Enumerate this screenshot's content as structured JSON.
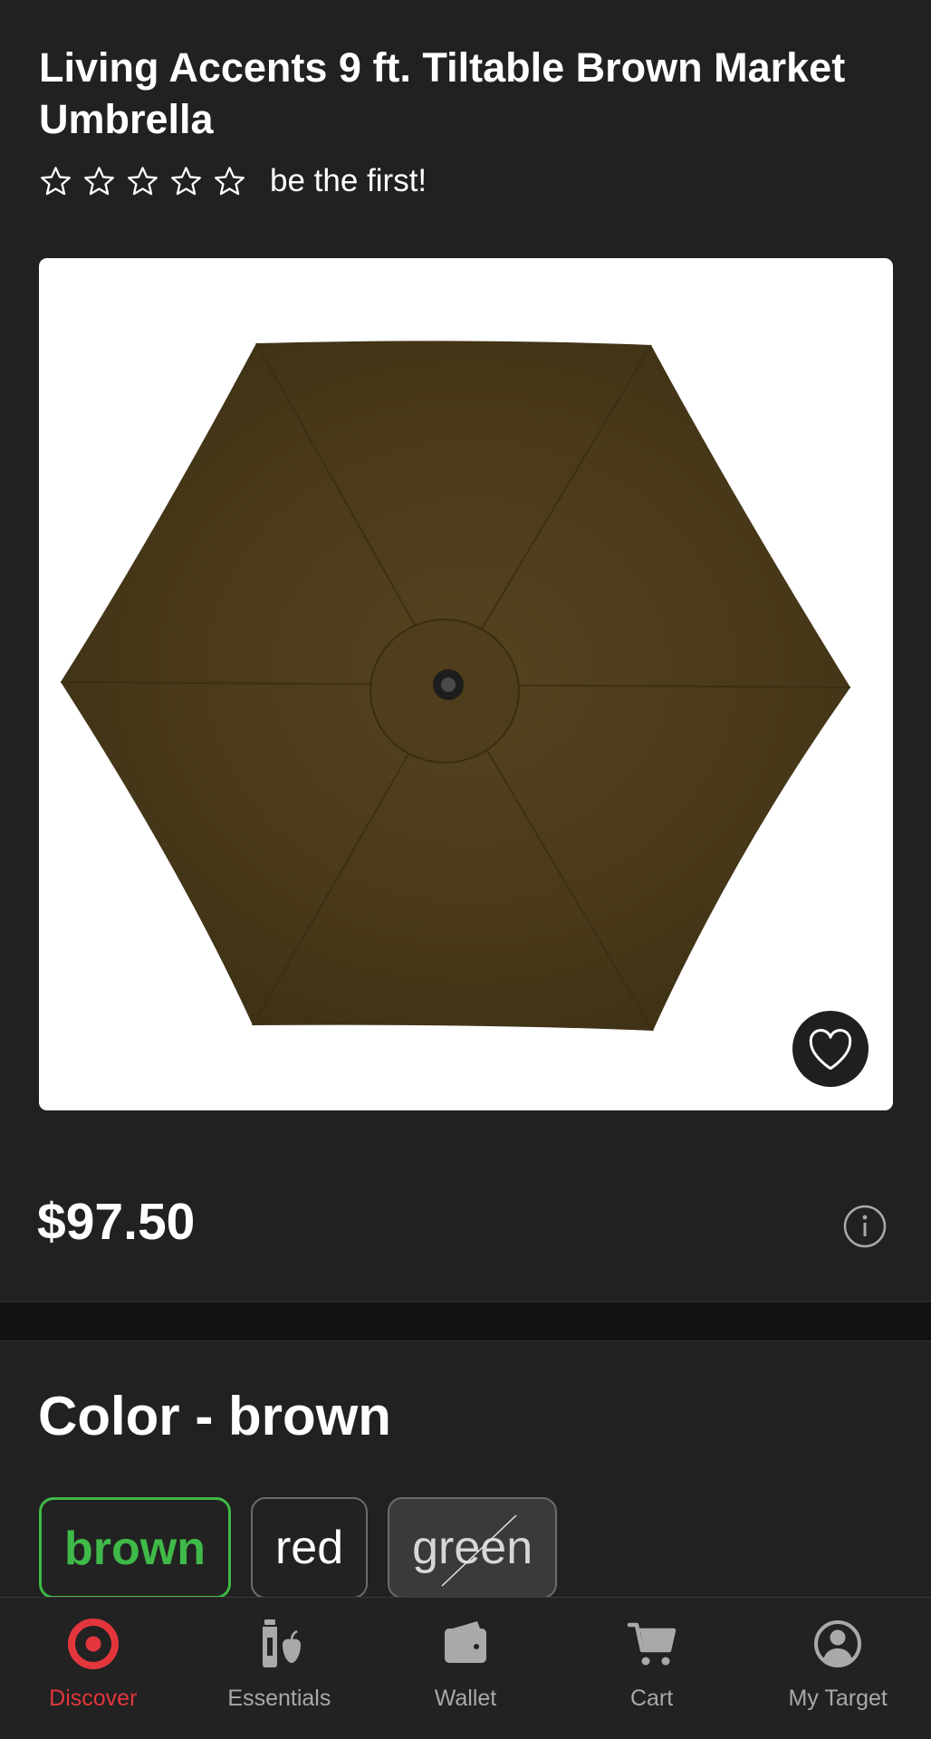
{
  "product": {
    "title": "Living Accents 9 ft. Tiltable Brown Market Umbrella",
    "rating_value": 0,
    "rating_max": 5,
    "rating_prompt": "be the first!",
    "price": "$97.50"
  },
  "variations": {
    "heading": "Color - brown",
    "options": [
      {
        "label": "brown",
        "state": "selected"
      },
      {
        "label": "red",
        "state": "available"
      },
      {
        "label": "green",
        "state": "unavailable"
      }
    ]
  },
  "tabs": [
    {
      "label": "Discover",
      "icon": "target-bullseye-icon",
      "active": true
    },
    {
      "label": "Essentials",
      "icon": "grocery-icon",
      "active": false
    },
    {
      "label": "Wallet",
      "icon": "wallet-icon",
      "active": false
    },
    {
      "label": "Cart",
      "icon": "cart-icon",
      "active": false
    },
    {
      "label": "My Target",
      "icon": "account-icon",
      "active": false
    }
  ],
  "colors": {
    "background": "#212121",
    "selected_accent": "#3fb947",
    "active_tab": "#e2363c",
    "inactive_tab": "#a9a9a9",
    "umbrella_canopy": "#4a3a1a"
  }
}
